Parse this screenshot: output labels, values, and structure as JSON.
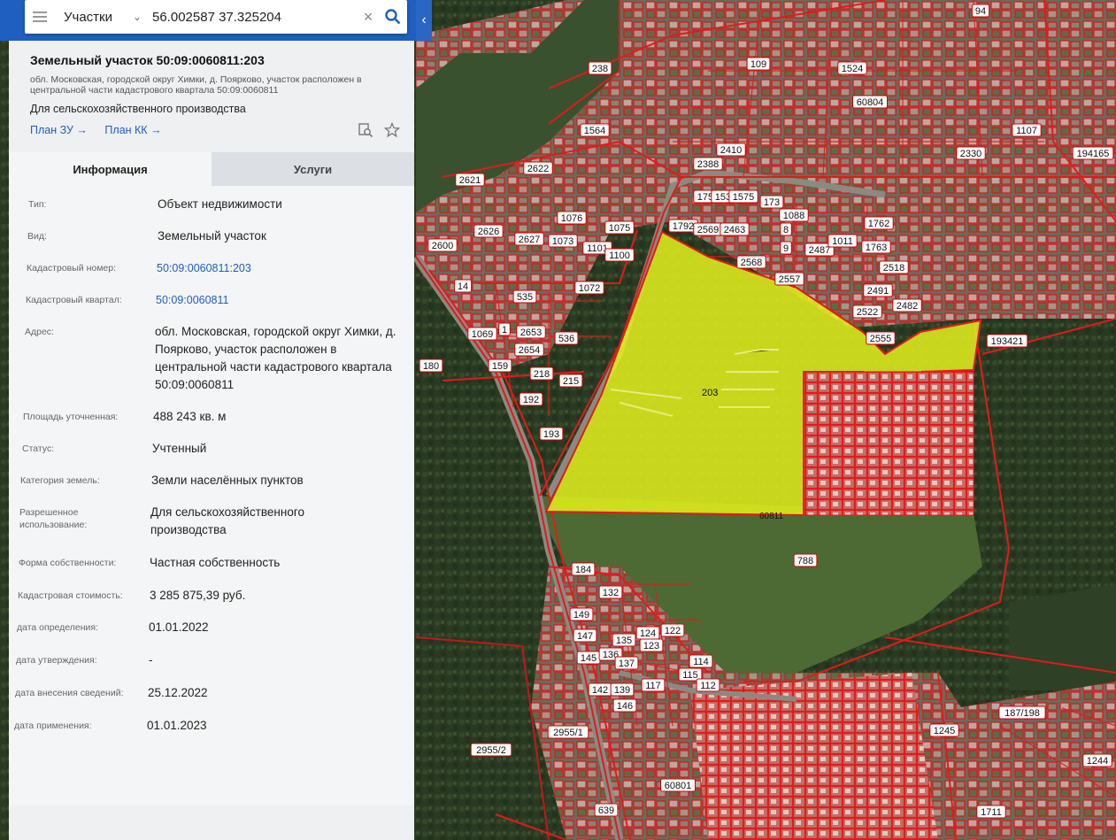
{
  "search": {
    "scope": "Участки",
    "query": "56.002587 37.325204"
  },
  "parcel": {
    "title": "Земельный участок 50:09:0060811:203",
    "address_short": "обл. Московская, городской округ Химки, д. Поярково, участок расположен в центральной части кадастрового квартала 50:09:0060811",
    "usage_short": "Для сельскохозяйственного производства",
    "link_plan_zu": "План ЗУ →",
    "link_plan_kk": "План КК →"
  },
  "tabs": [
    "Информация",
    "Услуги"
  ],
  "info": [
    {
      "key": "Тип:",
      "value": "Объект недвижимости"
    },
    {
      "key": "Вид:",
      "value": "Земельный участок"
    },
    {
      "key": "Кадастровый номер:",
      "value": "50:09:0060811:203"
    },
    {
      "key": "Кадастровый квартал:",
      "value": "50:09:0060811"
    },
    {
      "key": "Адрес:",
      "value": "обл. Московская, городской округ Химки, д. Поярково, участок расположен в центральной части кадастрового квартала 50:09:0060811"
    },
    {
      "key": "Площадь уточненная:",
      "value": "488 243 кв. м"
    },
    {
      "key": "Статус:",
      "value": "Учтенный"
    },
    {
      "key": "Категория земель:",
      "value": "Земли населённых пунктов"
    },
    {
      "key": "Разрешенное использование:",
      "value": "Для сельскохозяйственного производства"
    },
    {
      "key": "Форма собственности:",
      "value": "Частная собственность"
    },
    {
      "key": "Кадастровая стоимость:",
      "value": "3 285 875,39 руб."
    },
    {
      "key": "дата определения:",
      "value": "01.01.2022"
    },
    {
      "key": "дата утверждения:",
      "value": "-"
    },
    {
      "key": "дата внесения сведений:",
      "value": "25.12.2022"
    },
    {
      "key": "дата применения:",
      "value": "01.01.2023"
    }
  ],
  "map": {
    "highlight_color": "#e4f21c",
    "boundary_color": "#e11b1b",
    "selected_label": "203",
    "quarter_label": "60811",
    "labels": [
      "238",
      "109",
      "1524",
      "60804",
      "94",
      "1564",
      "2410",
      "2388",
      "2330",
      "1107",
      "194165",
      "2621",
      "2622",
      "1076",
      "1075",
      "1073",
      "1101",
      "1100",
      "2626",
      "2627",
      "2600",
      "1750",
      "1538",
      "1575",
      "173",
      "1088",
      "1762",
      "1792",
      "2569",
      "2463",
      "8",
      "9",
      "2487",
      "1011",
      "1763",
      "2518",
      "2568",
      "2557",
      "2491",
      "2482",
      "2522",
      "2555",
      "193421",
      "14",
      "535",
      "1072",
      "1069",
      "1",
      "2653",
      "536",
      "2654",
      "159",
      "218",
      "215",
      "180",
      "192",
      "193",
      "788",
      "184",
      "132",
      "149",
      "147",
      "145",
      "124",
      "123",
      "135",
      "136",
      "137",
      "122",
      "114",
      "115",
      "112",
      "142",
      "139",
      "146",
      "117",
      "2955/1",
      "2955/2",
      "60801",
      "1244",
      "1245",
      "187/198",
      "1711",
      "639"
    ]
  }
}
